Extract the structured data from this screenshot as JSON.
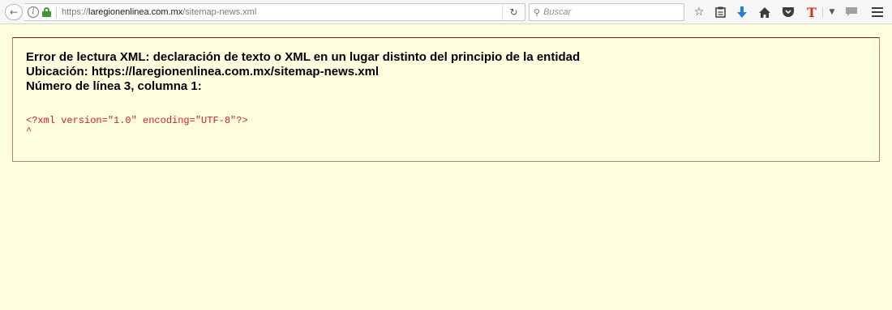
{
  "toolbar": {
    "back_icon": "back-arrow-icon",
    "url": {
      "prefix": "https://",
      "host": "laregionenlinea.com.mx",
      "path": "/sitemap-news.xml"
    },
    "search_placeholder": "Buscar",
    "icons": [
      "star-icon",
      "reading-list-icon",
      "downloads-icon",
      "home-icon",
      "pocket-icon",
      "t-extension-icon",
      "menu-icon"
    ],
    "download_color": "#1f7ee0",
    "t_extension_color": "#d5321c",
    "t_extension_label": "T"
  },
  "error": {
    "title": "Error de lectura XML: declaración de texto o XML en un lugar distinto del principio de la entidad",
    "location": "Ubicación: https://laregionenlinea.com.mx/sitemap-news.xml",
    "line": "Número de línea 3, columna 1:",
    "source": "<?xml version=\"1.0\" encoding=\"UTF-8\"?>",
    "caret": "^",
    "text_color": "#e01b1b",
    "background": "#ffffe0"
  }
}
